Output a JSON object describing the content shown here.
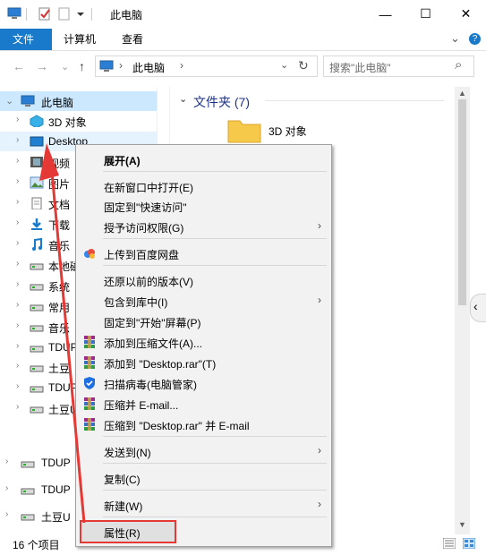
{
  "window": {
    "title": "此电脑",
    "min_glyph": "—",
    "max_glyph": "☐",
    "close_glyph": "✕",
    "colors": {
      "accent": "#1979ca",
      "annotation_red": "#e53935"
    }
  },
  "ribbon": {
    "tabs": [
      "文件",
      "计算机",
      "查看"
    ],
    "collapse_glyph": "⌄",
    "help_glyph": "?"
  },
  "nav": {
    "back_glyph": "←",
    "forward_glyph": "→",
    "recent_glyph": "⌄",
    "up_glyph": "↑",
    "address_text": "此电脑",
    "address_chevron": "›",
    "address_dropdown": "⌄",
    "refresh_glyph": "↻",
    "search_placeholder": "搜索\"此电脑\"",
    "search_icon": "⌕"
  },
  "tree": {
    "items": [
      {
        "label": "此电脑",
        "icon": "computer-icon"
      },
      {
        "label": "3D 对象",
        "icon": "3d-icon"
      },
      {
        "label": "Desktop",
        "icon": "desktop-icon"
      },
      {
        "label": "视频",
        "icon": "video-icon"
      },
      {
        "label": "图片",
        "icon": "picture-icon"
      },
      {
        "label": "文档",
        "icon": "document-icon"
      },
      {
        "label": "下载",
        "icon": "download-icon"
      },
      {
        "label": "音乐",
        "icon": "music-icon"
      },
      {
        "label": "本地磁盘",
        "icon": "drive-icon"
      },
      {
        "label": "系统",
        "icon": "drive-icon"
      },
      {
        "label": "常用",
        "icon": "drive-icon"
      },
      {
        "label": "音乐",
        "icon": "drive-icon"
      },
      {
        "label": "TDUP",
        "icon": "drive-icon"
      },
      {
        "label": "土豆",
        "icon": "drive-icon"
      },
      {
        "label": "TDUP",
        "icon": "drive-icon"
      },
      {
        "label": "土豆U",
        "icon": "drive-icon"
      },
      {
        "label": "TDUP",
        "icon": "drive-icon"
      },
      {
        "label": "TDUP",
        "icon": "drive-icon"
      },
      {
        "label": "土豆U",
        "icon": "drive-icon"
      }
    ],
    "chevron": "›"
  },
  "content": {
    "group_header": "文件夹 (7)",
    "group_chevron": "⌄",
    "folder_label": "3D 对象"
  },
  "context_menu": {
    "items": [
      {
        "label": "展开(A)",
        "bold": true
      },
      {
        "label": "在新窗口中打开(E)"
      },
      {
        "label": "固定到\"快速访问\""
      },
      {
        "label": "授予访问权限(G)",
        "submenu": true
      },
      {
        "label": "上传到百度网盘",
        "icon": "baidu-cloud-icon"
      },
      {
        "label": "还原以前的版本(V)"
      },
      {
        "label": "包含到库中(I)",
        "submenu": true
      },
      {
        "label": "固定到\"开始\"屏幕(P)"
      },
      {
        "label": "添加到压缩文件(A)...",
        "icon": "winrar-icon"
      },
      {
        "label": "添加到 \"Desktop.rar\"(T)",
        "icon": "winrar-icon"
      },
      {
        "label": "扫描病毒(电脑管家)",
        "icon": "shield-icon"
      },
      {
        "label": "压缩并 E-mail...",
        "icon": "winrar-icon"
      },
      {
        "label": "压缩到 \"Desktop.rar\" 并 E-mail",
        "icon": "winrar-icon"
      },
      {
        "label": "发送到(N)",
        "submenu": true
      },
      {
        "label": "复制(C)"
      },
      {
        "label": "新建(W)",
        "submenu": true
      },
      {
        "label": "属性(R)",
        "highlighted": true
      }
    ],
    "submenu_glyph": "›"
  },
  "status": {
    "count_text": "16 个项目"
  }
}
